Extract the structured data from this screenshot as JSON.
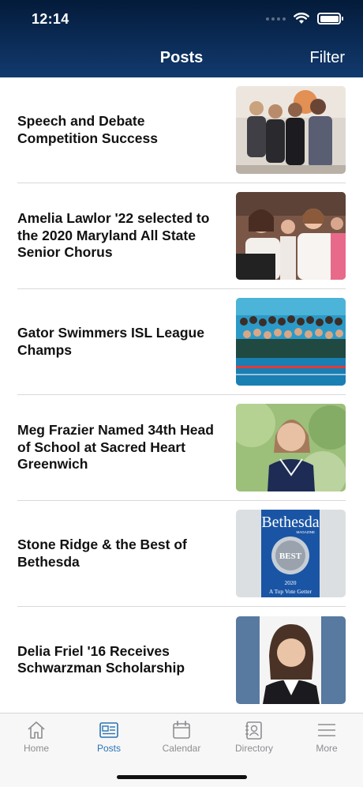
{
  "status_bar": {
    "time": "12:14"
  },
  "header": {
    "title": "Posts",
    "filter_label": "Filter"
  },
  "posts": [
    {
      "title": "Speech and Debate Competition Success",
      "image": "group-photo-students"
    },
    {
      "title": "Amelia Lawlor '22 selected to the 2020 Maryland All State Senior Chorus",
      "image": "chorus-singers-photo"
    },
    {
      "title": "Gator Swimmers ISL League Champs",
      "image": "swim-team-pool-photo"
    },
    {
      "title": "Meg Frazier Named 34th Head of School at Sacred Heart Greenwich",
      "image": "portrait-photo-woman"
    },
    {
      "title": "Stone Ridge & the Best of Bethesda",
      "image": "bethesda-magazine-badge",
      "badge": {
        "brand": "Bethesda",
        "sub": "MAGAZINE",
        "seal": "BEST",
        "year": "2020",
        "caption": "A Top Vote Getter"
      }
    },
    {
      "title": "Delia Friel '16  Receives Schwarzman Scholarship",
      "image": "portrait-photo-student"
    }
  ],
  "tabs": [
    {
      "label": "Home",
      "icon": "home-icon",
      "active": false
    },
    {
      "label": "Posts",
      "icon": "news-icon",
      "active": true
    },
    {
      "label": "Calendar",
      "icon": "calendar-icon",
      "active": false
    },
    {
      "label": "Directory",
      "icon": "directory-icon",
      "active": false
    },
    {
      "label": "More",
      "icon": "menu-icon",
      "active": false
    }
  ],
  "colors": {
    "header_dark": "#041b3a",
    "header_light": "#123a6e",
    "tab_active": "#2c74b3",
    "tab_inactive": "#8e8e93"
  }
}
